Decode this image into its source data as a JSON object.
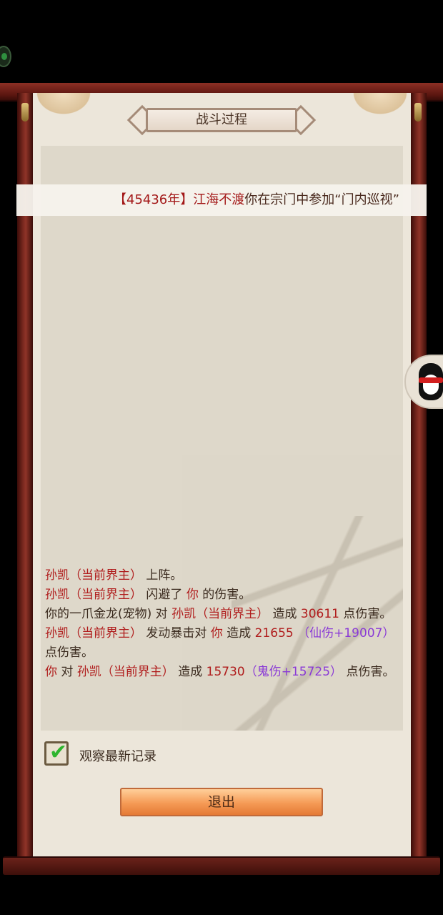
{
  "title": "战斗过程",
  "banner": {
    "open": "【",
    "year": "45436年",
    "close": "】",
    "name": "江海不渡",
    "text": "你在宗门中参加“门内巡视”"
  },
  "log": [
    {
      "segments": [
        {
          "t": "孙凯（当前界主）",
          "c": "red"
        },
        {
          "t": " 上阵。",
          "c": "dark"
        }
      ]
    },
    {
      "segments": [
        {
          "t": "孙凯（当前界主）",
          "c": "red"
        },
        {
          "t": " 闪避了 ",
          "c": "dark"
        },
        {
          "t": "你",
          "c": "red"
        },
        {
          "t": " 的伤害。",
          "c": "dark"
        }
      ]
    },
    {
      "segments": [
        {
          "t": "你的一爪金龙(宠物)",
          "c": "dark"
        },
        {
          "t": " 对 ",
          "c": "dark"
        },
        {
          "t": "孙凯（当前界主）",
          "c": "red"
        },
        {
          "t": " 造成 ",
          "c": "dark"
        },
        {
          "t": "30611",
          "c": "red"
        },
        {
          "t": " 点伤害。",
          "c": "dark"
        }
      ]
    },
    {
      "segments": [
        {
          "t": "孙凯（当前界主）",
          "c": "red"
        },
        {
          "t": " 发动暴击对 ",
          "c": "dark"
        },
        {
          "t": "你",
          "c": "red"
        },
        {
          "t": " 造成 ",
          "c": "dark"
        },
        {
          "t": "21655",
          "c": "red"
        },
        {
          "t": " （仙伤+19007）",
          "c": "purple"
        },
        {
          "t": "点伤害。",
          "c": "dark"
        }
      ]
    },
    {
      "segments": [
        {
          "t": "你",
          "c": "red"
        },
        {
          "t": " 对 ",
          "c": "dark"
        },
        {
          "t": "孙凯（当前界主）",
          "c": "red"
        },
        {
          "t": " 造成 ",
          "c": "dark"
        },
        {
          "t": "15730",
          "c": "red"
        },
        {
          "t": "（鬼伤+15725）",
          "c": "purple"
        },
        {
          "t": " 点伤害。",
          "c": "dark"
        }
      ]
    }
  ],
  "checkbox": {
    "label": "观察最新记录",
    "checked": true
  },
  "exit_label": "退出",
  "icons": {
    "check": "check-icon",
    "qq": "qq-penguin-icon",
    "bell": "bell-icon"
  }
}
